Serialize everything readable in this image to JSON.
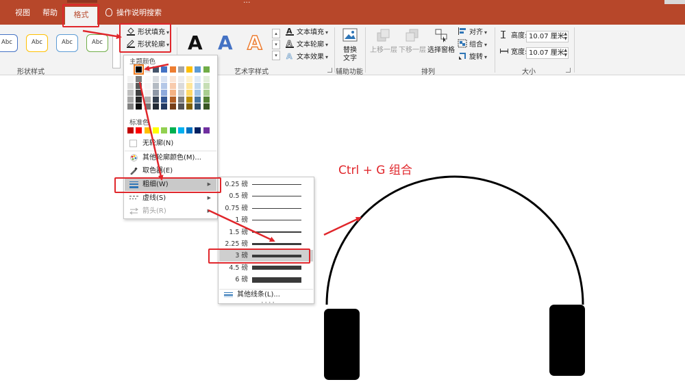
{
  "tabs": {
    "view": "视图",
    "help": "帮助",
    "format": "格式",
    "search": "操作说明搜索",
    "doc_title": "..."
  },
  "ribbon": {
    "shape_styles": {
      "label": "形状样式",
      "thumbs": [
        "Abc",
        "Abc",
        "Abc",
        "Abc"
      ],
      "thumb_colors": [
        "#4472c4",
        "#ffc000",
        "#5b9bd5",
        "#70ad47"
      ],
      "fill": "形状填充",
      "outline": "形状轮廓"
    },
    "wordart": {
      "label": "艺术字样式",
      "letter": "A",
      "text_fill": "文本填充",
      "text_outline": "文本轮廓",
      "text_effects": "文本效果"
    },
    "accessibility": {
      "label": "辅助功能",
      "alt_text_line1": "替换",
      "alt_text_line2": "文字"
    },
    "arrange": {
      "label": "排列",
      "bring_forward": "上移一层",
      "send_backward": "下移一层",
      "selection_pane": "选择窗格",
      "align": "对齐",
      "group": "组合",
      "rotate": "旋转"
    },
    "size": {
      "label": "大小",
      "height_label": "高度:",
      "height_value": "10.07 厘米",
      "width_label": "宽度:",
      "width_value": "10.07 厘米"
    }
  },
  "outline_menu": {
    "theme_colors": "主题颜色",
    "standard_colors": "标准色",
    "no_outline": "无轮廓(N)",
    "more_colors": "其他轮廓颜色(M)...",
    "eyedropper": "取色器(E)",
    "weight": "粗细(W)",
    "dashes": "虚线(S)",
    "arrows": "箭头(R)",
    "theme_top_row": [
      "#ffffff",
      "#000000",
      "#e7e6e6",
      "#44546a",
      "#4472c4",
      "#ed7d31",
      "#a5a5a5",
      "#ffc000",
      "#5b9bd5",
      "#70ad47"
    ],
    "standard_row": [
      "#c00000",
      "#ff0000",
      "#ffc000",
      "#ffff00",
      "#92d050",
      "#00b050",
      "#00b0f0",
      "#0070c0",
      "#002060",
      "#7030a0"
    ]
  },
  "weight_menu": {
    "items": [
      {
        "label": "0.25 磅",
        "pt": 0.25
      },
      {
        "label": "0.5 磅",
        "pt": 0.5
      },
      {
        "label": "0.75 磅",
        "pt": 0.75
      },
      {
        "label": "1 磅",
        "pt": 1
      },
      {
        "label": "1.5 磅",
        "pt": 1.5
      },
      {
        "label": "2.25 磅",
        "pt": 2.25
      },
      {
        "label": "3 磅",
        "pt": 3
      },
      {
        "label": "4.5 磅",
        "pt": 4.5
      },
      {
        "label": "6 磅",
        "pt": 6
      }
    ],
    "selected": "3 磅",
    "more_lines": "其他线条(L)..."
  },
  "annotation": {
    "text": "Ctrl + G  组合",
    "color": "#e0262b"
  },
  "colors": {
    "accent": "#b7472a",
    "ribbon_bg": "#f3f3f3"
  }
}
